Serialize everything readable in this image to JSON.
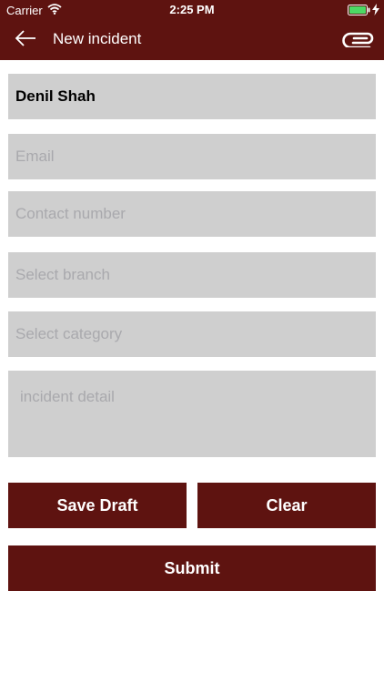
{
  "status_bar": {
    "carrier": "Carrier",
    "time": "2:25 PM"
  },
  "nav": {
    "title": "New incident"
  },
  "form": {
    "name_value": "Denil Shah",
    "email_placeholder": "Email",
    "contact_placeholder": "Contact number",
    "branch_placeholder": "Select branch",
    "category_placeholder": "Select category",
    "detail_placeholder": "incident detail"
  },
  "actions": {
    "save_draft_label": "Save Draft",
    "clear_label": "Clear",
    "submit_label": "Submit"
  },
  "colors": {
    "brand": "#5e1310",
    "field_background": "#cfcfcf",
    "placeholder": "#a9a9ad"
  },
  "icons": {
    "back": "back-arrow-icon",
    "attach": "paperclip-icon",
    "wifi": "wifi-icon",
    "battery": "battery-icon",
    "charging": "charging-icon"
  }
}
